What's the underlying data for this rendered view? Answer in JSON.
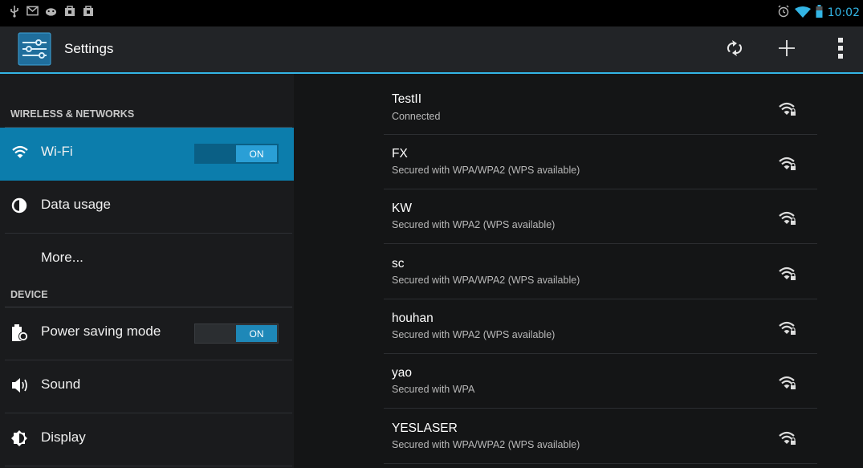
{
  "status_bar": {
    "left_icons": [
      "usb-icon",
      "gmail-icon",
      "android-debug-icon",
      "shopping-bag-icon",
      "shopping-bag-icon"
    ],
    "right_icons": [
      "alarm-icon",
      "wifi-icon",
      "battery-icon"
    ],
    "time": "10:02",
    "accent": "#33b5e5"
  },
  "action_bar": {
    "title": "Settings",
    "actions": [
      "wps-push-icon",
      "add-network-icon",
      "overflow-menu-icon"
    ]
  },
  "sidebar": {
    "sections": [
      {
        "header": "WIRELESS & NETWORKS"
      },
      {
        "header": "DEVICE"
      }
    ],
    "items": [
      {
        "label": "Wi-Fi",
        "icon": "wifi-icon",
        "toggle": "ON",
        "selected": true
      },
      {
        "label": "Data usage",
        "icon": "data-usage-icon"
      },
      {
        "label": "More...",
        "icon": ""
      },
      {
        "label": "Power saving mode",
        "icon": "battery-saver-icon",
        "toggle": "ON"
      },
      {
        "label": "Sound",
        "icon": "speaker-icon"
      },
      {
        "label": "Display",
        "icon": "brightness-icon"
      }
    ]
  },
  "networks": [
    {
      "name": "TestII",
      "status": "Connected"
    },
    {
      "name": "FX",
      "status": "Secured with WPA/WPA2 (WPS available)"
    },
    {
      "name": "KW",
      "status": "Secured with WPA2 (WPS available)"
    },
    {
      "name": "sc",
      "status": "Secured with WPA/WPA2 (WPS available)"
    },
    {
      "name": "houhan",
      "status": "Secured with WPA2 (WPS available)"
    },
    {
      "name": "yao",
      "status": "Secured with WPA"
    },
    {
      "name": "YESLASER",
      "status": "Secured with WPA/WPA2 (WPS available)"
    }
  ],
  "colors": {
    "accent": "#33b5e5",
    "selected_item": "#0c7dac",
    "toggle_on": "#1e88b8"
  }
}
